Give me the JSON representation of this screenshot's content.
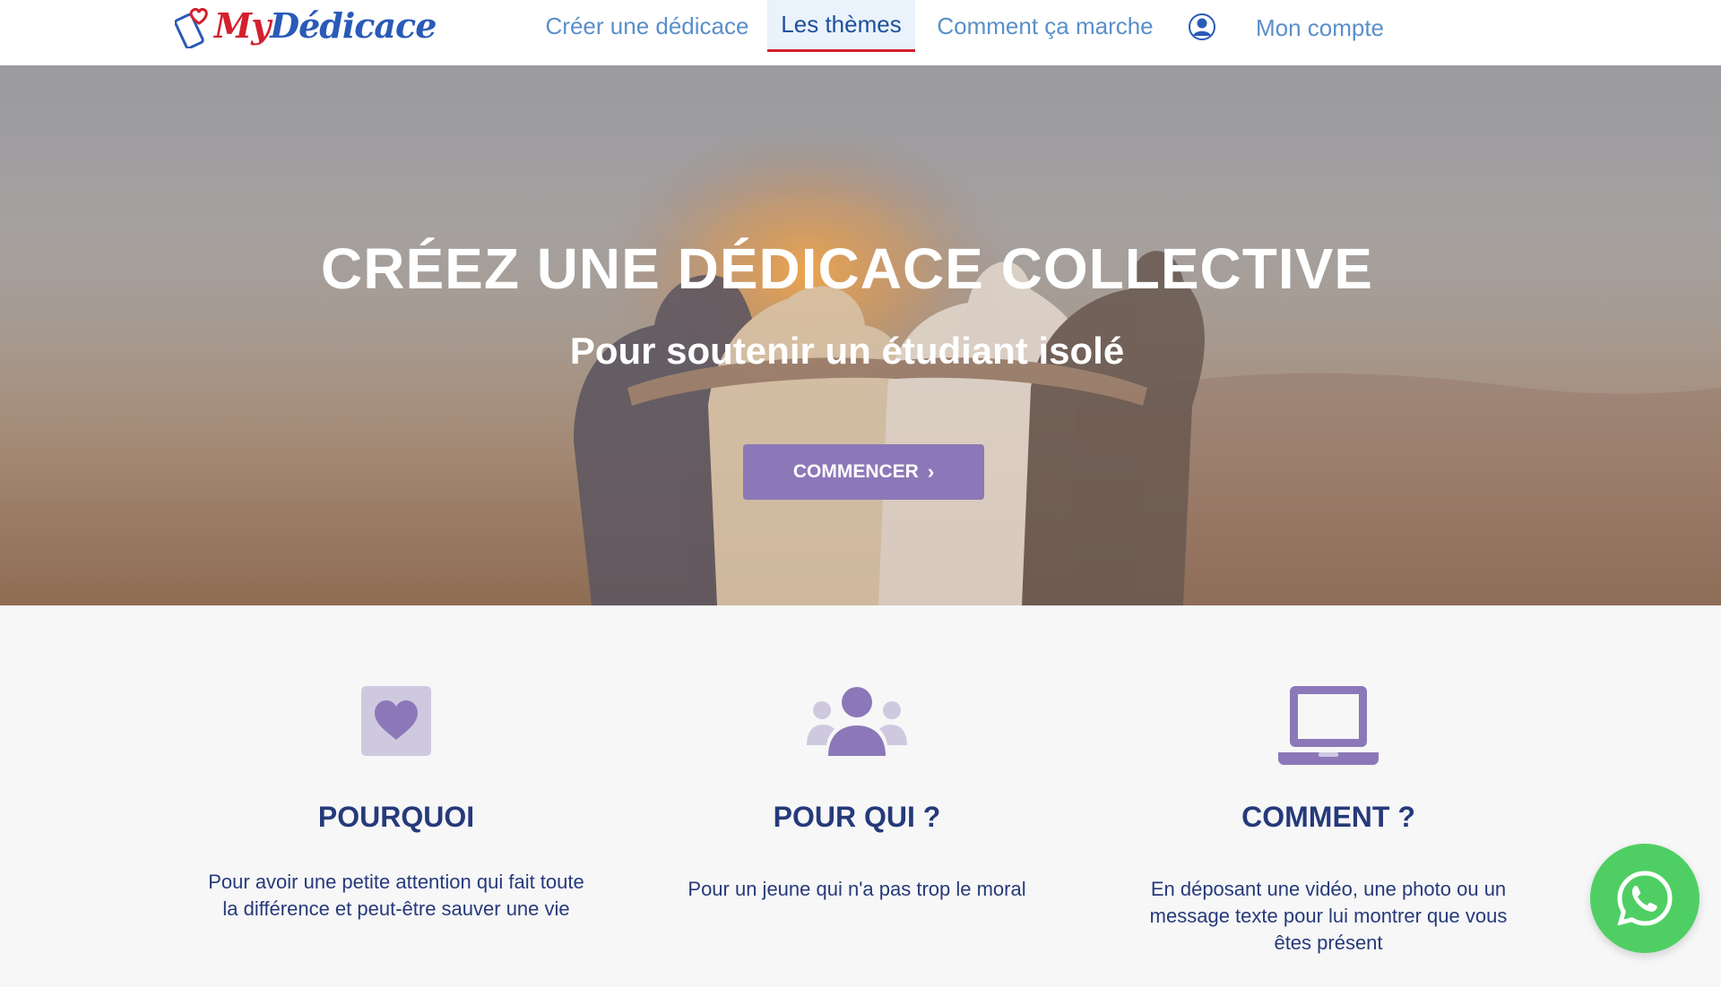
{
  "brand": {
    "logo_my": "My",
    "logo_dedicace": "Dédicace"
  },
  "nav": {
    "items": [
      {
        "label": "Créer une dédicace",
        "active": false
      },
      {
        "label": "Les thèmes",
        "active": true
      },
      {
        "label": "Comment ça marche",
        "active": false
      }
    ],
    "account_icon": "user-circle-icon",
    "account_label": "Mon compte"
  },
  "hero": {
    "title": "CRÉEZ UNE DÉDICACE COLLECTIVE",
    "subtitle": "Pour soutenir un étudiant isolé",
    "cta_label": "COMMENCER",
    "cta_icon": "chevron-right-icon"
  },
  "features": [
    {
      "icon": "heart-icon",
      "title": "POURQUOI",
      "text": "Pour avoir une petite attention qui fait toute la différence et peut-être sauver une vie"
    },
    {
      "icon": "users-icon",
      "title": "POUR QUI ?",
      "text": "Pour un jeune qui n'a pas trop le moral"
    },
    {
      "icon": "laptop-icon",
      "title": "COMMENT ?",
      "text": "En déposant une vidéo, une photo ou un message texte pour lui montrer que vous êtes présent"
    }
  ],
  "floating": {
    "icon": "whatsapp-icon"
  },
  "colors": {
    "accent": "#8c78b8",
    "nav_link": "#5a8fc9",
    "title": "#263a7a",
    "brand_red": "#d4202e",
    "brand_blue": "#2a5ab8",
    "whatsapp": "#4fcf63"
  }
}
